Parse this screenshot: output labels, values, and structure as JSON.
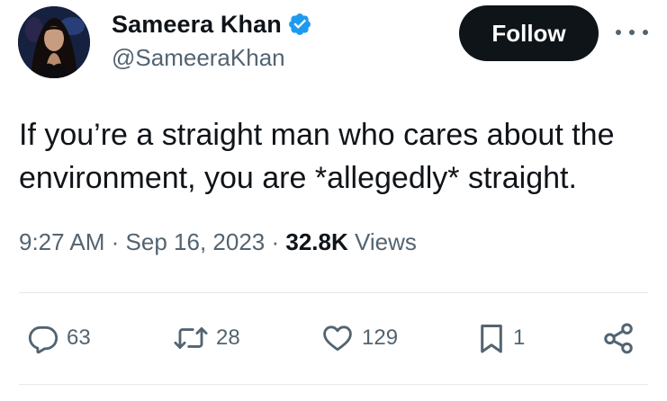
{
  "author": {
    "display_name": "Sameera Khan",
    "handle": "@SameeraKhan",
    "verified": true
  },
  "follow_label": "Follow",
  "tweet": {
    "lines": [
      "If you’re a straight man who cares about the",
      "environment, you are *allegedly* straight."
    ]
  },
  "meta": {
    "time": "9:27 AM",
    "separator": "·",
    "date": "Sep 16, 2023",
    "views_count": "32.8K",
    "views_label": "Views"
  },
  "actions": {
    "replies": "63",
    "retweets": "28",
    "likes": "129",
    "bookmarks": "1"
  },
  "colors": {
    "text_primary": "#0f1419",
    "text_secondary": "#536471",
    "follow_bg": "#0f1419",
    "verified_blue": "#1d9bf0",
    "divider": "#e6e9ec"
  },
  "icons": {
    "verified": "verified-badge-icon",
    "more": "more-dots-icon",
    "reply": "reply-bubble-icon",
    "retweet": "retweet-icon",
    "like": "heart-icon",
    "bookmark": "bookmark-icon",
    "share": "share-icon"
  }
}
